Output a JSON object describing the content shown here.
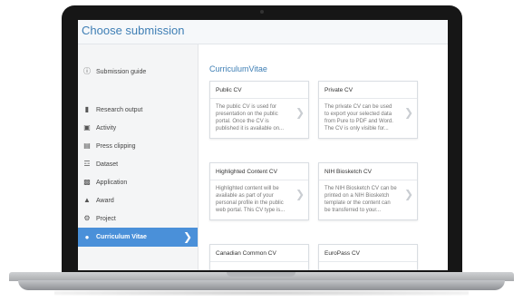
{
  "dialog": {
    "title": "Choose submission"
  },
  "sidebar": {
    "items": [
      {
        "label": "Submission guide",
        "icon": "help-circle-icon",
        "active": false
      },
      {
        "label": "Research output",
        "icon": "book-icon",
        "active": false
      },
      {
        "label": "Activity",
        "icon": "briefcase-icon",
        "active": false
      },
      {
        "label": "Press clipping",
        "icon": "newspaper-icon",
        "active": false
      },
      {
        "label": "Dataset",
        "icon": "database-icon",
        "active": false
      },
      {
        "label": "Application",
        "icon": "bar-chart-icon",
        "active": false
      },
      {
        "label": "Award",
        "icon": "trophy-icon",
        "active": false
      },
      {
        "label": "Project",
        "icon": "gear-icon",
        "active": false
      },
      {
        "label": "Curriculum Vitae",
        "icon": "circle-icon",
        "active": true
      }
    ]
  },
  "main": {
    "section_title": "CurriculumVitae",
    "cards": [
      {
        "title": "Public CV",
        "body": [
          "The public CV is used for",
          "presentation on the public",
          "portal. Once the CV is",
          "published it is available on..."
        ]
      },
      {
        "title": "Private CV",
        "body": [
          "The private CV can be used",
          "to export your selected data",
          "from Pure to PDF and Word.",
          "The CV is only visible for..."
        ]
      },
      {
        "title": "Highlighted Content CV",
        "body": [
          "Highlighted content will be",
          "available as part of your",
          "personal profile in the public",
          "web portal. This CV type is..."
        ]
      },
      {
        "title": "NIH Biosketch CV",
        "body": [
          "The NIH Biosketch CV can be",
          "printed on a NIH Biosketch",
          "template or the content can",
          "be transferred to your..."
        ]
      },
      {
        "title": "Canadian Common CV",
        "body": []
      },
      {
        "title": "EuroPass CV",
        "body": []
      }
    ]
  },
  "colors": {
    "accent": "#4a90d9",
    "title": "#3f7fb5",
    "bezel": "#161616"
  }
}
